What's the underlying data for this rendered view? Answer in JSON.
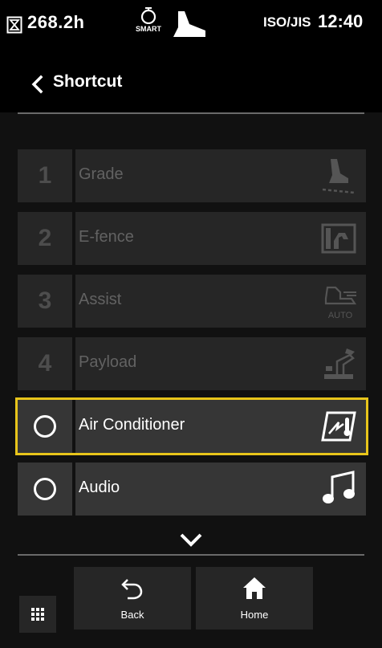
{
  "status": {
    "hours": "268.2h",
    "mode_label": "SMART",
    "pattern": "ISO/JIS",
    "time": "12:40"
  },
  "header": {
    "title": "Shortcut"
  },
  "shortcuts": [
    {
      "number": "1",
      "label": "Grade",
      "icon": "grade-icon"
    },
    {
      "number": "2",
      "label": "E-fence",
      "icon": "e-fence-icon"
    },
    {
      "number": "3",
      "label": "Assist",
      "icon": "assist-auto-icon",
      "icon_text": "AUTO"
    },
    {
      "number": "4",
      "label": "Payload",
      "icon": "payload-icon"
    },
    {
      "number": "",
      "label": "Air Conditioner",
      "icon": "air-conditioner-icon",
      "selected": true
    },
    {
      "number": "",
      "label": "Audio",
      "icon": "music-note-icon"
    }
  ],
  "softkeys": {
    "back_label": "Back",
    "home_label": "Home"
  },
  "colors": {
    "highlight": "#e8c51b",
    "background": "#111111",
    "row_disabled": "#262626",
    "row_active": "#363636"
  }
}
